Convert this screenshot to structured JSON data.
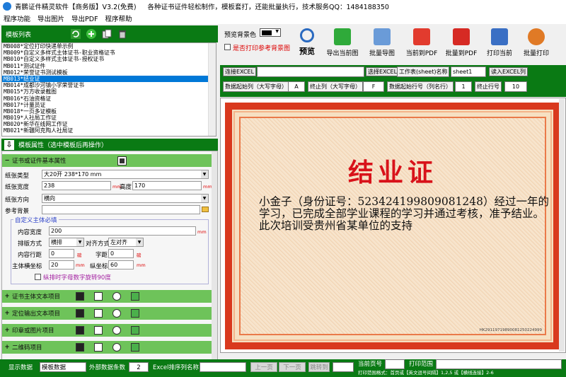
{
  "window": {
    "title": "青鹏证件精灵软件【商务版】V3.2(免费)",
    "slogan": "各种证书证件轻松制作，模板套打，还能批量执行，技术服务QQ：1484188350"
  },
  "menu": [
    "程序功能",
    "导出图片",
    "导出PDF",
    "程序帮助"
  ],
  "templates": {
    "header": "模板列表",
    "items": [
      "MB008*定位打印快递单示例",
      "MB009*自定义多样式主体证书-职业资格证书",
      "MB010*自定义多样式主体证书-授权证书",
      "MB011*测试证件",
      "MB012*荣誉证书测试模板",
      "MB013*结业证",
      "MB014*成都沙河镇小学荣誉证书",
      "MB015*万方收录截图",
      "MB016*石油资格证",
      "MB017*计量员证",
      "MB018*一页多证模板",
      "MB019*人社局工作证",
      "MB020*新华在线网工作证",
      "MB021*新疆阿克陶人社局证"
    ],
    "selected_index": 5
  },
  "props": {
    "header": "模板属性（选中模板后再操作）",
    "section_basic": "证书或证件基本属性",
    "paper_spec_label": "纸张类型",
    "paper_spec": "大20开 238*170 mm",
    "paper_width_label": "纸张宽度",
    "paper_width": "238",
    "paper_height_label": "高度",
    "paper_height": "170",
    "paper_dir_label": "纸张方向",
    "paper_dir": "横向",
    "bg_label": "参考背景",
    "custom_legend": "自定义主体必填",
    "content_width_label": "内容宽度",
    "content_width": "200",
    "layout_label": "排版方式",
    "layout": "横排",
    "align_label": "对齐方式",
    "align": "左对齐",
    "line_spacing_label": "内容行距",
    "line_spacing": "0",
    "char_spacing_label": "字距",
    "char_spacing": "0",
    "main_x_label": "主体横坐标",
    "main_x": "20",
    "main_y_label": "纵坐标",
    "main_y": "60",
    "rotate_label": "纵排时字母数字旋转90度",
    "unit_mm": "mm",
    "unit_pt": "磅",
    "sections": [
      "证书主体文本项目",
      "定位输出文本项目",
      "印章或图片项目",
      "二维码项目"
    ]
  },
  "toolbar": {
    "bg_color_label": "预览背景色",
    "print_ref_bg": "是否打印参考背景图",
    "buttons": [
      "预览",
      "导出当前图",
      "批量导图",
      "当前到PDF",
      "批量到PDF",
      "打印当前",
      "批量打印"
    ]
  },
  "excel": {
    "connect": "连接EXCEL",
    "select": "选择EXCEL",
    "sheet_label": "工作表(sheet)名称",
    "sheet_value": "sheet1",
    "read": "读入EXCEL列",
    "start_col_label": "数据起始列（大写字母）",
    "start_col": "A",
    "end_col_label": "终止列（大写字母）",
    "end_col": "F",
    "start_row_label": "数据起始行号（列名行）",
    "start_row": "1",
    "end_row_label": "终止行号",
    "end_row": "10"
  },
  "certificate": {
    "title": "结业证",
    "body": "小金子（身份证号：523424199809081248）经过一年的学习，已完成全部学业课程的学习并通过考核，准予结业。此次培训受贵州省某单位的支持",
    "code": "HK29119719890081250224999"
  },
  "bottom": {
    "show_data_label": "显示数据",
    "show_data_value": "模板数据",
    "ext_count_label": "外部数据条数",
    "ext_count": "2",
    "sort_label": "Excel排序列名称",
    "prev": "上一页",
    "next": "下一页",
    "jump": "跳转到",
    "current_page_label": "当前页号",
    "print_range_label": "打印范围",
    "hint": "打印范围格式：首页或【英文逗号间隔】1,2,5 或【横线连接】2-6"
  },
  "colors": {
    "green_dark": "#0a7a14",
    "green_section": "#6ec35a",
    "cert_border": "#d9391e",
    "cert_title": "#d8121a"
  }
}
